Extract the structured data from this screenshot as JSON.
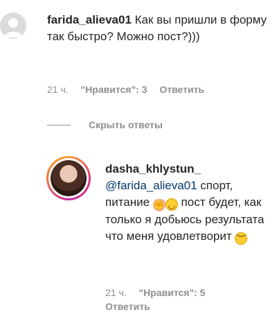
{
  "comment_1": {
    "username": "farida_alieva01",
    "text": "Как вы пришли в форму так быстро? Можно пост?)))",
    "time": "21 ч.",
    "likes": "\"Нравится\": 3",
    "reply": "Ответить"
  },
  "hide_replies": "Скрыть ответы",
  "comment_2": {
    "username": "dasha_khlystun_",
    "mention": "@farida_alieva01",
    "text_part1": " спорт, питание ",
    "text_part2": " пост будет, как только я добьюсь результата что меня удовлетворит ",
    "time": "21 ч.",
    "likes": "\"Нравится\": 5",
    "reply": "Ответить",
    "emoji_1": "flexed-biceps-icon",
    "emoji_2": "smiling-face-icon",
    "emoji_3": "pensive-face-icon"
  }
}
